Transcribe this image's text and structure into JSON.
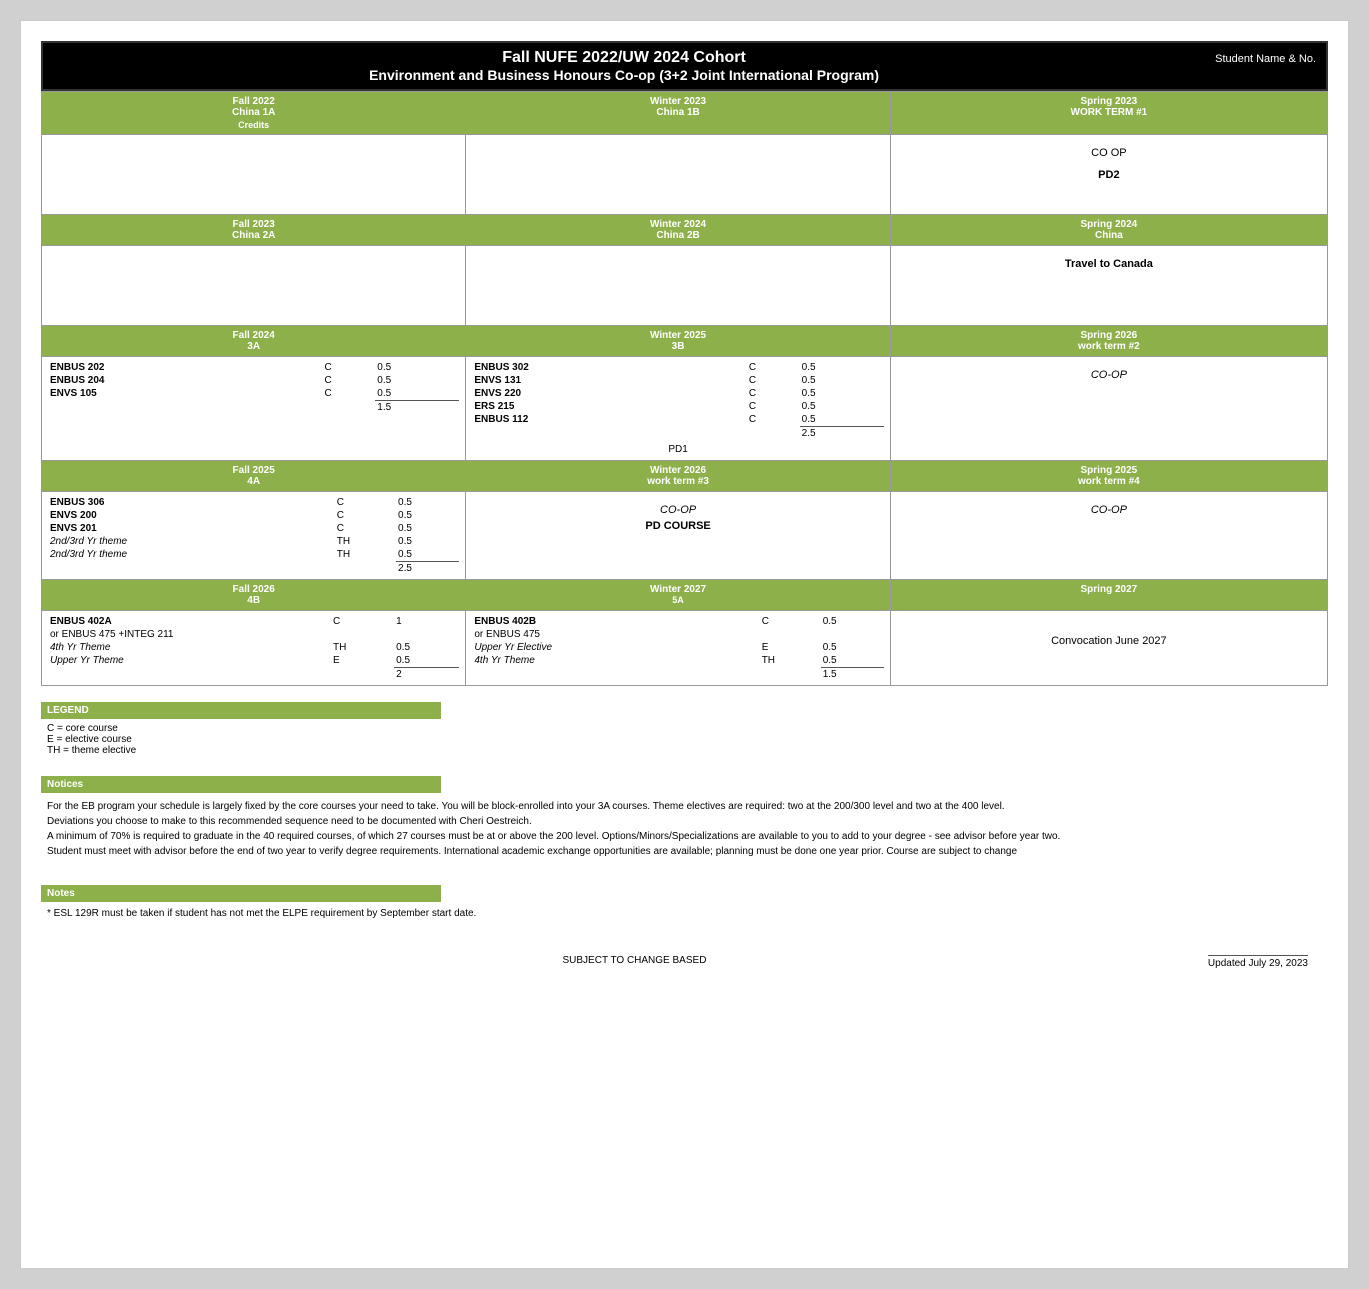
{
  "header": {
    "title1": "Fall NUFE 2022/UW 2024 Cohort",
    "title2": "Environment and Business Honours Co-op (3+2 Joint International Program)",
    "student_label": "Student Name & No."
  },
  "sections": {
    "row1": {
      "fall": {
        "label": "Fall 2022",
        "sublabel": "China 1A",
        "credits_label": "Credits"
      },
      "winter": {
        "label": "Winter 2023",
        "sublabel": "China 1B"
      },
      "spring": {
        "label": "Spring 2023",
        "sublabel": "WORK TERM #1"
      }
    },
    "row2": {
      "fall": {
        "label": "Fall 2023",
        "sublabel": "China 2A"
      },
      "winter": {
        "label": "Winter 2024",
        "sublabel": "China 2B"
      },
      "spring": {
        "label": "Spring 2024",
        "sublabel": "China"
      }
    },
    "row3": {
      "fall": {
        "label": "Fall 2024",
        "sublabel": "3A"
      },
      "winter": {
        "label": "Winter 2025",
        "sublabel": "3B"
      },
      "spring": {
        "label": "Spring 2026",
        "sublabel": "work term #2"
      }
    },
    "row4": {
      "fall": {
        "label": "Fall 2025",
        "sublabel": "4A"
      },
      "winter": {
        "label": "Winter 2026",
        "sublabel": "work term #3"
      },
      "spring": {
        "label": "Spring 2025",
        "sublabel": "work term #4"
      }
    },
    "row5": {
      "fall": {
        "label": "Fall 2026",
        "sublabel": "4B"
      },
      "winter": {
        "label": "Winter 2027",
        "sublabel": ""
      },
      "spring": {
        "label": "Spring 2027",
        "sublabel": ""
      }
    }
  },
  "row1_content": {
    "spring": {
      "lines": [
        "CO OP",
        "",
        "PD2"
      ]
    }
  },
  "row2_content": {
    "spring": {
      "lines": [
        "Travel to Canada"
      ]
    }
  },
  "row3_content": {
    "fall_courses": [
      {
        "name": "ENBUS 202",
        "type": "C",
        "credits": "0.5"
      },
      {
        "name": "ENBUS 204",
        "type": "C",
        "credits": "0.5"
      },
      {
        "name": "ENVS 105",
        "type": "C",
        "credits": "0.5"
      }
    ],
    "fall_total": "1.5",
    "winter_courses": [
      {
        "name": "ENBUS 302",
        "type": "C",
        "credits": "0.5"
      },
      {
        "name": "ENVS 131",
        "type": "C",
        "credits": "0.5"
      },
      {
        "name": "ENVS 220",
        "type": "C",
        "credits": "0.5"
      },
      {
        "name": "ERS 215",
        "type": "C",
        "credits": "0.5"
      },
      {
        "name": "ENBUS 112",
        "type": "C",
        "credits": "0.5"
      }
    ],
    "winter_total": "2.5",
    "winter_extra": "PD1",
    "spring_content": "CO-OP"
  },
  "row4_content": {
    "fall_courses": [
      {
        "name": "ENBUS 306",
        "type": "C",
        "credits": "0.5"
      },
      {
        "name": "ENVS 200",
        "type": "C",
        "credits": "0.5"
      },
      {
        "name": "ENVS 201",
        "type": "C",
        "credits": "0.5"
      },
      {
        "name": "2nd/3rd Yr theme",
        "italic": true,
        "type": "TH",
        "credits": "0.5"
      },
      {
        "name": "2nd/3rd Yr theme",
        "italic": true,
        "type": "TH",
        "credits": "0.5"
      }
    ],
    "fall_total": "2.5",
    "winter_content1": "CO-OP",
    "winter_content2": "PD COURSE",
    "spring_content": "CO-OP"
  },
  "row5_content": {
    "fall_label5b": "5A",
    "fall_courses": [
      {
        "name": "ENBUS 402A",
        "type": "C",
        "credits": "1"
      },
      {
        "name": "or ENBUS 475 +INTEG 211",
        "type": "",
        "credits": ""
      },
      {
        "name": "4th Yr Theme",
        "italic": true,
        "type": "TH",
        "credits": "0.5"
      },
      {
        "name": "Upper Yr Theme",
        "italic": true,
        "type": "E",
        "credits": "0.5"
      }
    ],
    "fall_total": "2",
    "winter_courses": [
      {
        "name": "ENBUS 402B",
        "type": "C",
        "credits": "0.5"
      },
      {
        "name": "or ENBUS 475",
        "type": "",
        "credits": ""
      },
      {
        "name": "Upper Yr Elective",
        "italic": true,
        "type": "E",
        "credits": "0.5"
      },
      {
        "name": "4th Yr Theme",
        "italic": true,
        "type": "TH",
        "credits": "0.5"
      }
    ],
    "winter_total": "1.5",
    "spring_content": "Convocation June 2027"
  },
  "legend": {
    "header": "LEGEND",
    "items": [
      "C = core course",
      "E = elective course",
      "TH = theme elective"
    ]
  },
  "notices": {
    "header": "Notices",
    "lines": [
      "For the EB program your schedule is largely fixed by the core courses your need to take. You will be block-enrolled into your 3A courses. Theme electives are required: two at the 200/300 level and two at the 400 level.",
      "Deviations you choose to make to this recommended sequence need to be documented with Cheri Oestreich.",
      "A minimum of 70% is required to graduate in the 40 required courses, of which 27 courses must be at or above the 200 level. Options/Minors/Specializations are available to you to add to your degree - see advisor before year two.",
      "Student must meet with advisor before the end of two year to verify degree requirements. International academic exchange opportunities are available; planning must be done one year prior.  Course are subject to change"
    ]
  },
  "notes": {
    "header": "Notes",
    "lines": [
      "* ESL 129R must be taken if student has not met the ELPE requirement by September start date."
    ]
  },
  "footer": {
    "center": "SUBJECT TO CHANGE BASED",
    "right": "Updated July 29, 2023"
  }
}
